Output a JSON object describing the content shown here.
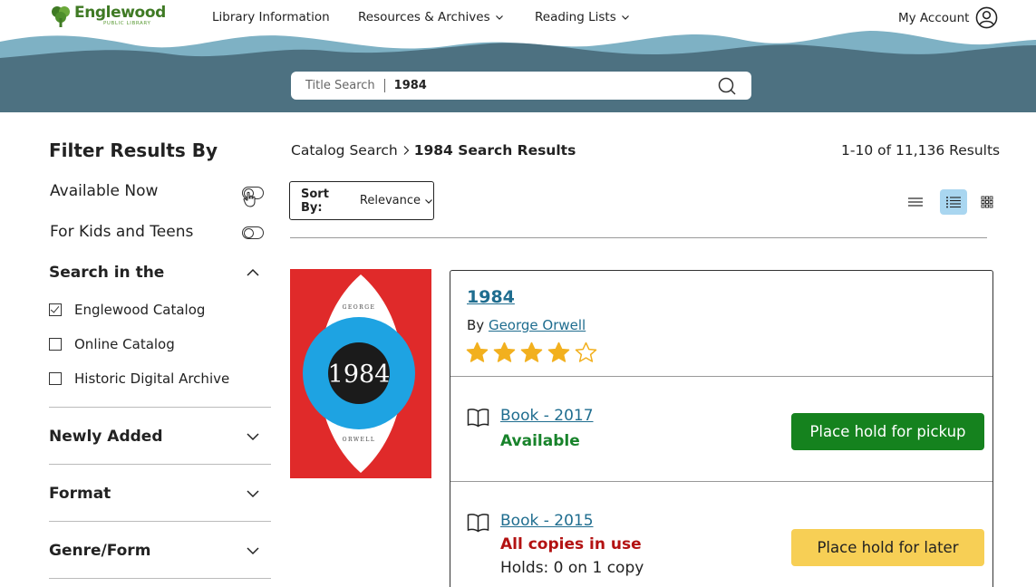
{
  "header": {
    "logo": {
      "name": "Englewood",
      "sub": "PUBLIC LIBRARY"
    },
    "nav": [
      {
        "label": "Library Information"
      },
      {
        "label": "Resources & Archives"
      },
      {
        "label": "Reading Lists"
      }
    ],
    "account_label": "My Account",
    "search": {
      "type_label": "Title Search",
      "value": "1984"
    }
  },
  "sidebar": {
    "title": "Filter Results By",
    "toggles": [
      {
        "label": "Available Now"
      },
      {
        "label": "For Kids and Teens"
      }
    ],
    "search_in": {
      "heading": "Search in the",
      "options": [
        {
          "label": "Englewood Catalog",
          "checked": true
        },
        {
          "label": "Online Catalog",
          "checked": false
        },
        {
          "label": "Historic Digital Archive",
          "checked": false
        }
      ]
    },
    "sections": [
      {
        "label": "Newly Added"
      },
      {
        "label": "Format"
      },
      {
        "label": "Genre/Form"
      }
    ]
  },
  "main": {
    "breadcrumb": {
      "link": "Catalog Search",
      "current": "1984 Search Results"
    },
    "results_count": "1-10 of 11,136 Results",
    "sort": {
      "label": "Sort By:",
      "value": "Relevance"
    },
    "views": [
      "list-view",
      "detailed-list-view",
      "grid-view"
    ],
    "active_view": "detailed-list-view",
    "result": {
      "title": "1984",
      "by": "By",
      "author": "George Orwell",
      "rating": 4,
      "rating_max": 5,
      "cover": {
        "top": "GEORGE",
        "title": "1984",
        "bottom": "ORWELL"
      },
      "editions": [
        {
          "label": "Book - 2017",
          "status": "Available",
          "action": "Place hold for pickup"
        },
        {
          "label": "Book - 2015",
          "status": "All copies in use",
          "holds": "Holds: 0 on 1 copy",
          "action": "Place hold for later"
        }
      ]
    }
  },
  "colors": {
    "link": "#1f6d8f",
    "available": "#18832b",
    "unavailable": "#b31212",
    "hold_pickup": "#15821e",
    "hold_later": "#f7cf55",
    "active_view": "#a9d6f0",
    "star": "#f2b01e"
  }
}
